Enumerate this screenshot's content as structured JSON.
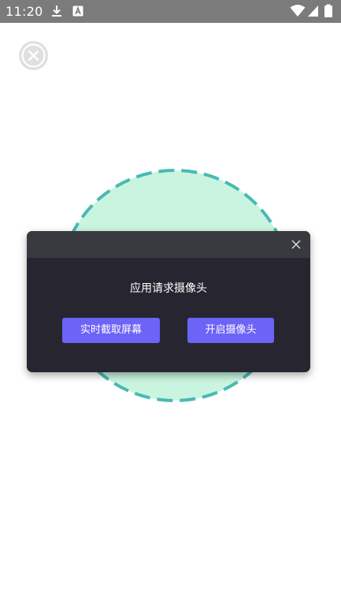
{
  "status_bar": {
    "time": "11:20",
    "icons": [
      "download-icon",
      "app-notification-icon",
      "wifi-icon",
      "signal-icon",
      "battery-icon"
    ]
  },
  "overlay": {
    "close_icon": "close-icon"
  },
  "dialog": {
    "message": "应用请求摄像头",
    "buttons": {
      "screen_capture": "实时截取屏幕",
      "open_camera": "开启摄像头"
    },
    "close_icon": "close-icon"
  },
  "colors": {
    "status_bar_bg": "#7b7b7b",
    "dialog_bg": "#272630",
    "dialog_header_bg": "#393940",
    "accent": "#6c63f7",
    "circle_fill": "#c9f5e0",
    "circle_dash": "#4ab9b3"
  }
}
